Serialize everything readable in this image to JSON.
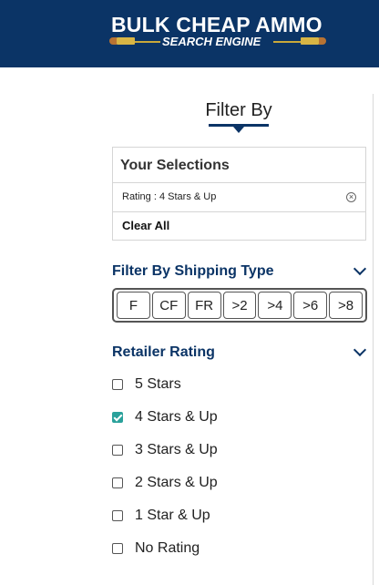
{
  "header": {
    "logo_title": "BULK CHEAP AMMO",
    "logo_subtitle": "SEARCH ENGINE",
    "bg_color": "#0b3466"
  },
  "filter": {
    "heading": "Filter By"
  },
  "selections": {
    "title": "Your Selections",
    "items": [
      {
        "label": "Rating : 4 Stars & Up"
      }
    ],
    "clear_all": "Clear All"
  },
  "shipping": {
    "title": "Filter By Shipping Type",
    "options": [
      "F",
      "CF",
      "FR",
      ">2",
      ">4",
      ">6",
      ">8"
    ]
  },
  "retailer_rating": {
    "title": "Retailer Rating",
    "options": [
      {
        "label": "5 Stars",
        "checked": false
      },
      {
        "label": "4 Stars & Up",
        "checked": true
      },
      {
        "label": "3 Stars & Up",
        "checked": false
      },
      {
        "label": "2 Stars & Up",
        "checked": false
      },
      {
        "label": "1 Star & Up",
        "checked": false
      },
      {
        "label": "No Rating",
        "checked": false
      }
    ]
  },
  "colors": {
    "accent": "#0b3466",
    "checkbox_checked": "#2aa19b"
  },
  "icons": {
    "remove": "close-circle-icon",
    "chevron": "chevron-down-icon",
    "filter_caret": "caret-down-icon"
  }
}
